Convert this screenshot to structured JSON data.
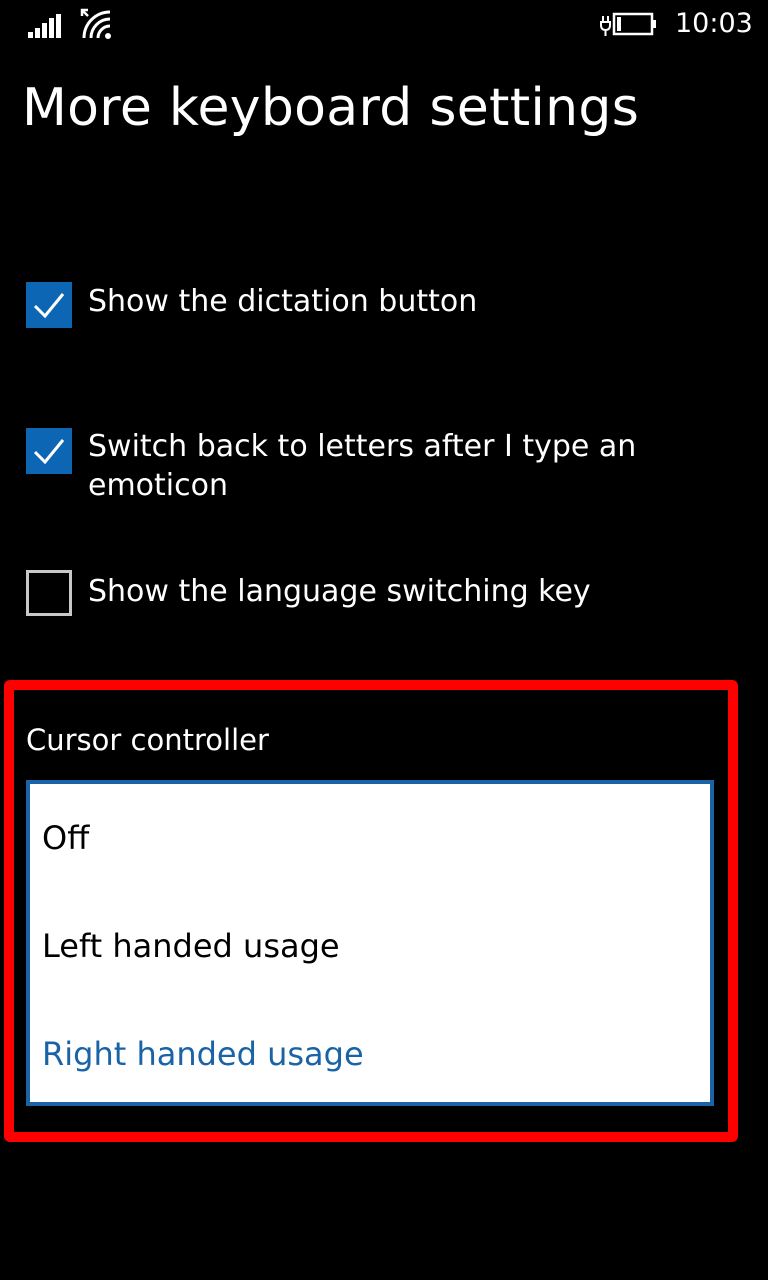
{
  "status_bar": {
    "time": "10:03",
    "icons": [
      "signal-strength-icon",
      "wifi-icon",
      "battery-charging-icon"
    ]
  },
  "page": {
    "title": "More keyboard settings"
  },
  "settings": {
    "options": [
      {
        "label": "Show the dictation button",
        "checked": true
      },
      {
        "label": "Switch back to letters after I type an emoticon",
        "checked": true
      },
      {
        "label": "Show the language switching key",
        "checked": false
      }
    ]
  },
  "cursor_controller": {
    "label": "Cursor controller",
    "options": [
      "Off",
      "Left handed usage",
      "Right handed usage"
    ],
    "selected": "Right handed usage"
  },
  "colors": {
    "background": "#000000",
    "accent": "#1963a6",
    "checkbox_fill": "#0c66b4",
    "highlight": "#ff0000"
  }
}
